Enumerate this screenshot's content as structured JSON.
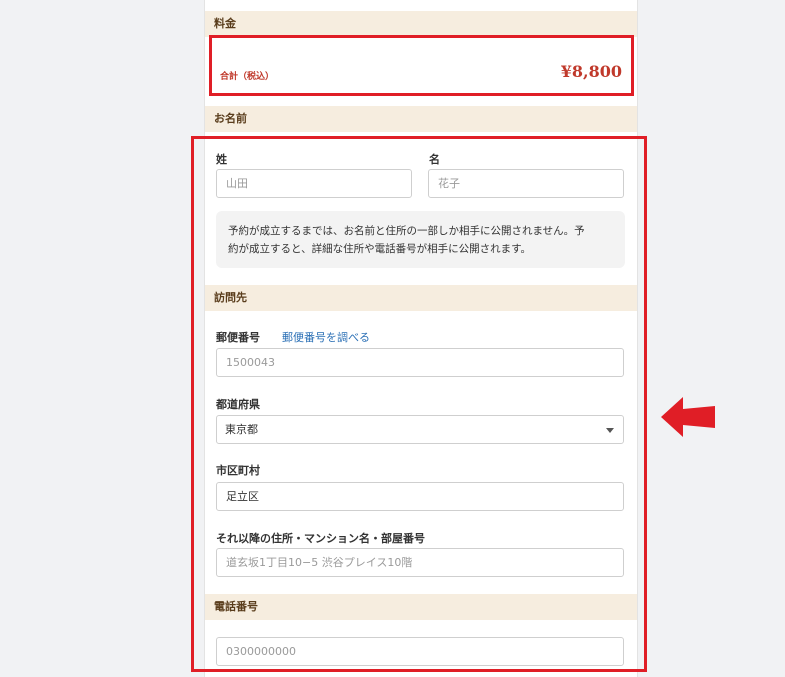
{
  "pricing": {
    "header": "料金",
    "total_label": "合計（税込）",
    "total_value": "¥8,800"
  },
  "name_section": {
    "header": "お名前",
    "last_name_label": "姓",
    "last_name_placeholder": "山田",
    "first_name_label": "名",
    "first_name_placeholder": "花子",
    "notice_line1": "予約が成立するまでは、お名前と住所の一部しか相手に公開されません。予",
    "notice_line2": "約が成立すると、詳細な住所や電話番号が相手に公開されます。"
  },
  "address_section": {
    "header": "訪問先",
    "postal_label": "郵便番号",
    "postal_link": "郵便番号を調べる",
    "postal_placeholder": "1500043",
    "prefecture_label": "都道府県",
    "prefecture_value": "東京都",
    "city_label": "市区町村",
    "city_value": "足立区",
    "street_label": "それ以降の住所・マンション名・部屋番号",
    "street_placeholder": "道玄坂1丁目10−5 渋谷プレイス10階"
  },
  "phone_section": {
    "header": "電話番号",
    "phone_placeholder": "0300000000"
  },
  "colors": {
    "highlight": "#e01e26",
    "section_header_bg": "#f6eddf",
    "price_text": "#c0392b",
    "link": "#2a6fb5"
  },
  "icons": {
    "pointer_arrow": "left-arrow-icon",
    "dropdown": "chevron-down-icon"
  }
}
